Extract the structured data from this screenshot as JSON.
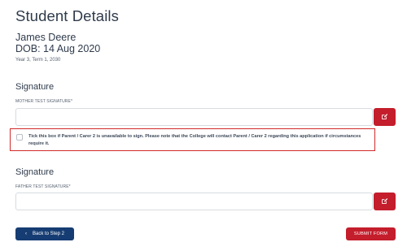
{
  "page": {
    "title": "Student Details"
  },
  "student": {
    "name": "James Deere",
    "dob": "DOB: 14 Aug 2020",
    "year_term": "Year 3, Term 1, 2030"
  },
  "mother_signature": {
    "section_title": "Signature",
    "label": "MOTHER TEST SIGNATURE*",
    "value": "",
    "edit_icon": "pencil-square-icon"
  },
  "carer_checkbox": {
    "checked": false,
    "text": "Tick this box if Parent / Carer 2 is unavailable to sign. Please note that the College will contact Parent / Carer 2 regarding this application if circumstances require it."
  },
  "father_signature": {
    "section_title": "Signature",
    "label": "FATHER TEST SIGNATURE*",
    "value": "",
    "edit_icon": "pencil-square-icon"
  },
  "actions": {
    "back_label": "Back to Step 2",
    "back_icon": "chevron-left-icon",
    "submit_label": "SUBMIT FORM"
  },
  "colors": {
    "primary_navy": "#163d73",
    "accent_red": "#c41d2c",
    "highlight_border": "#d12a2a",
    "text": "#2f3b4c"
  }
}
